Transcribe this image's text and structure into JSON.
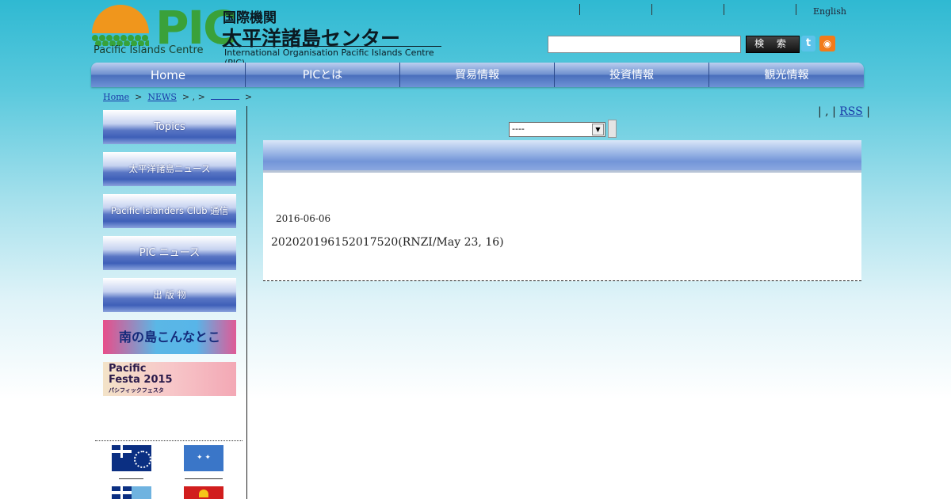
{
  "header": {
    "logo_letters": "PIC",
    "logo_subtitle": "Pacific Islands Centre",
    "org_line1": "国際機関",
    "org_line2": "太平洋諸島センター",
    "org_line3": "International Organisation  Pacific Islands Centre (PIC)",
    "english_link": "English",
    "search_placeholder": "",
    "search_button": "検 索",
    "twitter_icon": "t",
    "rss_icon": "◉"
  },
  "nav": {
    "items": [
      {
        "label": "Home"
      },
      {
        "label": "PICとは"
      },
      {
        "label": "貿易情報"
      },
      {
        "label": "投資情報"
      },
      {
        "label": "観光情報"
      }
    ]
  },
  "breadcrumb": {
    "home": "Home",
    "sep": ">",
    "news": "NEWS",
    "middle": ">  ,  >",
    "end": ">"
  },
  "sidebar": {
    "items": [
      {
        "label": "Topics"
      },
      {
        "label": "太平洋諸島ニュース"
      },
      {
        "label": "Pacific Islanders Club 通信"
      },
      {
        "label": "PIC ニュース"
      },
      {
        "label": "出 版 物"
      }
    ],
    "banner1": "南の島こんなとこ",
    "banner2_line1": "Pacific",
    "banner2_line2": "Festa 2015",
    "banner2_line3": "パシフィックフェスタ",
    "flag_fsm_label": "✦  ✦"
  },
  "main": {
    "rss_prefix": "| , |",
    "rss_link": "RSS",
    "rss_suffix": "|",
    "category_select": "----",
    "post_date": "2016-06-06",
    "post_text": "202020196152017520(RNZI/May 23, 16)"
  },
  "colors": {
    "nav_blue": "#4a6fbc",
    "logo_green": "#3aa13a",
    "logo_orange": "#f0961c"
  }
}
